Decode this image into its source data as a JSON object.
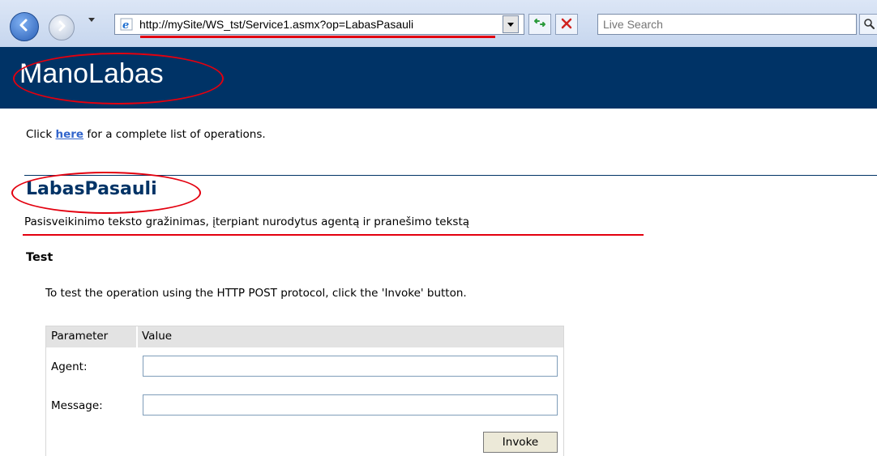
{
  "browser": {
    "address_url": "http://mySite/WS_tst/Service1.asmx?op=LabasPasauli",
    "search_placeholder": "Live Search"
  },
  "page": {
    "service_title": "ManoLabas",
    "intro_prefix": "Click ",
    "intro_link": "here",
    "intro_suffix": " for a complete list of operations.",
    "operation_title": "LabasPasauli",
    "operation_description": "Pasisveikinimo teksto gražinimas, įterpiant nurodytus agentą ir pranešimo tekstą",
    "test_heading": "Test",
    "test_instructions": "To test the operation using the HTTP POST protocol, click the 'Invoke' button."
  },
  "form": {
    "header_parameter": "Parameter",
    "header_value": "Value",
    "fields": [
      {
        "label": "Agent:",
        "value": ""
      },
      {
        "label": "Message:",
        "value": ""
      }
    ],
    "invoke_label": "Invoke"
  },
  "colors": {
    "banner": "#003366",
    "annotation": "#e3000f",
    "link": "#3366cc"
  }
}
